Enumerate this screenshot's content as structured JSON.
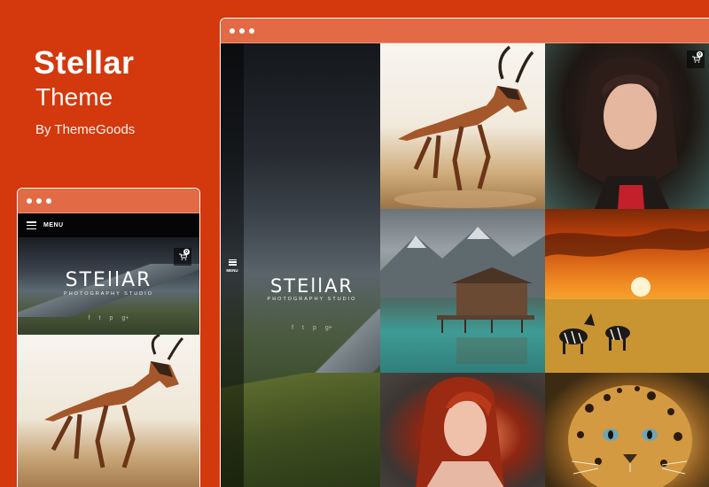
{
  "promo": {
    "title": "Stellar",
    "subtitle": "Theme",
    "byline": "By ThemeGoods"
  },
  "mobile_preview": {
    "menu_label": "MENU",
    "cart_count": "0",
    "logo": "STEllAR",
    "logo_tagline": "PHOTOGRAPHY STUDIO",
    "social_icons": [
      "f",
      "t",
      "p",
      "g+"
    ]
  },
  "desktop_preview": {
    "menu_label": "MENU",
    "cart_count": "0",
    "logo": "STEllAR",
    "logo_tagline": "PHOTOGRAPHY STUDIO",
    "social_icons": [
      "f",
      "t",
      "p",
      "g+"
    ]
  },
  "colors": {
    "background": "#d4380d",
    "window_bar": "#e26a45"
  }
}
